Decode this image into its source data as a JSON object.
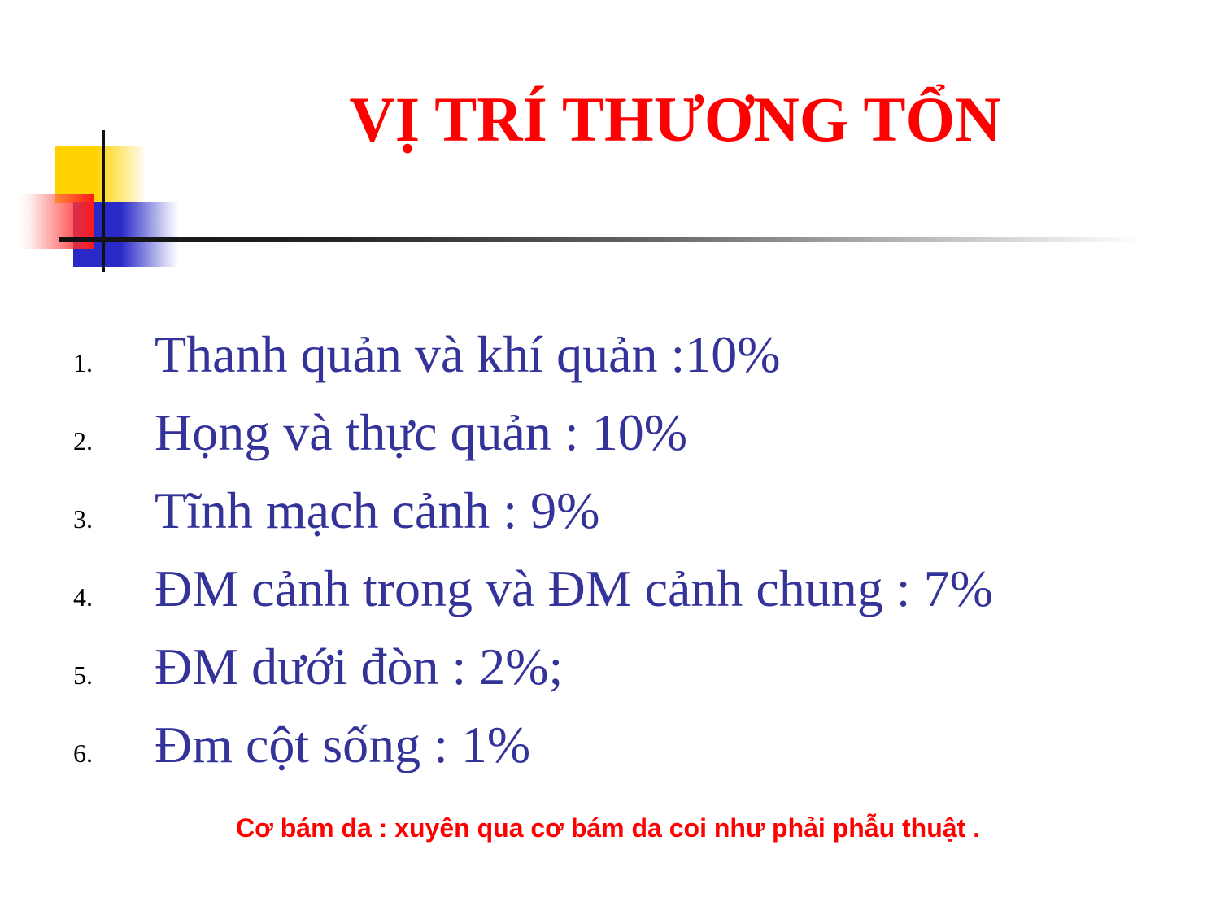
{
  "title": "VỊ TRÍ THƯƠNG TỔN",
  "items": [
    {
      "number": "1.",
      "text": "Thanh quản và khí quản :10%"
    },
    {
      "number": "2.",
      "text": "Họng và thực quản : 10%"
    },
    {
      "number": "3.",
      "text": "Tĩnh mạch cảnh : 9%"
    },
    {
      "number": "4.",
      "text": "ĐM cảnh trong và ĐM cảnh chung : 7%"
    },
    {
      "number": "5.",
      "text": "ĐM dưới đòn : 2%;"
    },
    {
      "number": "6.",
      "text": "Đm cột sống : 1%"
    }
  ],
  "note": "Cơ bám da : xuyên qua cơ bám da coi như phải phẫu thuật .",
  "colors": {
    "title": "#ff0000",
    "list_text": "#333399",
    "note": "#ff0000",
    "deco_yellow": "#ffd200",
    "deco_blue": "#2929c8",
    "deco_red": "#ff1a1a"
  }
}
